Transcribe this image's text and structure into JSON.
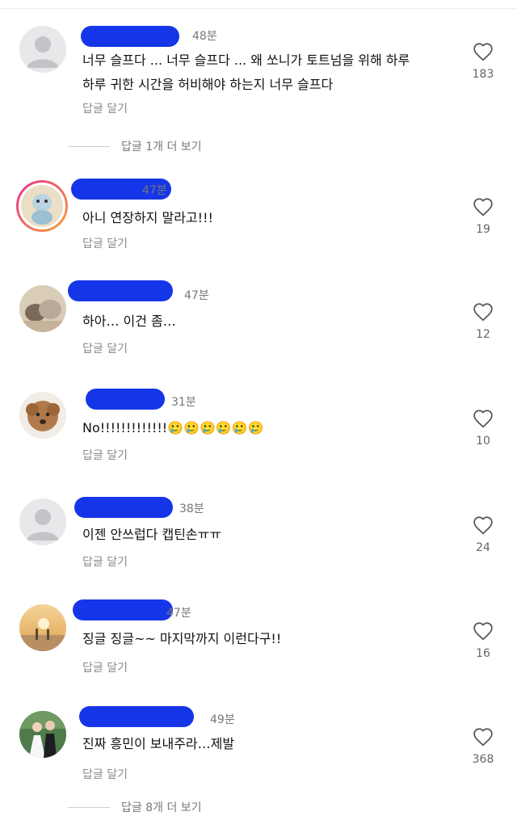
{
  "comments": [
    {
      "time": "48분",
      "text_line1": "너무 슬프다 ... 너무 슬프다 ... 왜 쏘니가 토트넘을 위해 하루",
      "text_line2": "하루 귀한 시간을 허비해야 하는지 너무 슬프다",
      "reply": "답글 달기",
      "likes": "183",
      "more_replies": "답글 1개 더 보기",
      "avatar": "default-avatar"
    },
    {
      "time": "47분",
      "text": "아니 연장하지 말라고!!!",
      "reply": "답글 달기",
      "likes": "19",
      "avatar": "character-avatar"
    },
    {
      "time": "47분",
      "text": "하아… 이건 좀…",
      "reply": "답글 달기",
      "likes": "12",
      "avatar": "cat-avatar"
    },
    {
      "time": "31분",
      "text": "No!!!!!!!!!!!!!🥲🥲🥲🥲🥲🥲",
      "reply": "답글 달기",
      "likes": "10",
      "avatar": "dog-avatar"
    },
    {
      "time": "38분",
      "text": "이젠 안쓰럽다 캡틴손ㅠㅠ",
      "reply": "답글 달기",
      "likes": "24",
      "avatar": "default-avatar"
    },
    {
      "time": "47분",
      "text": "징글 징글~~ 마지막까지 이런다구!!",
      "reply": "답글 달기",
      "likes": "16",
      "avatar": "sunset-avatar"
    },
    {
      "time": "49분",
      "text": "진짜 흥민이 보내주라…제발",
      "reply": "답글 달기",
      "likes": "368",
      "more_replies": "답글 8개 더 보기",
      "avatar": "wedding-avatar"
    }
  ],
  "colors": {
    "redaction": "#1536e8",
    "muted": "#8a8a8a",
    "text": "#111111"
  },
  "icons": {
    "like": "heart-outline-icon"
  }
}
